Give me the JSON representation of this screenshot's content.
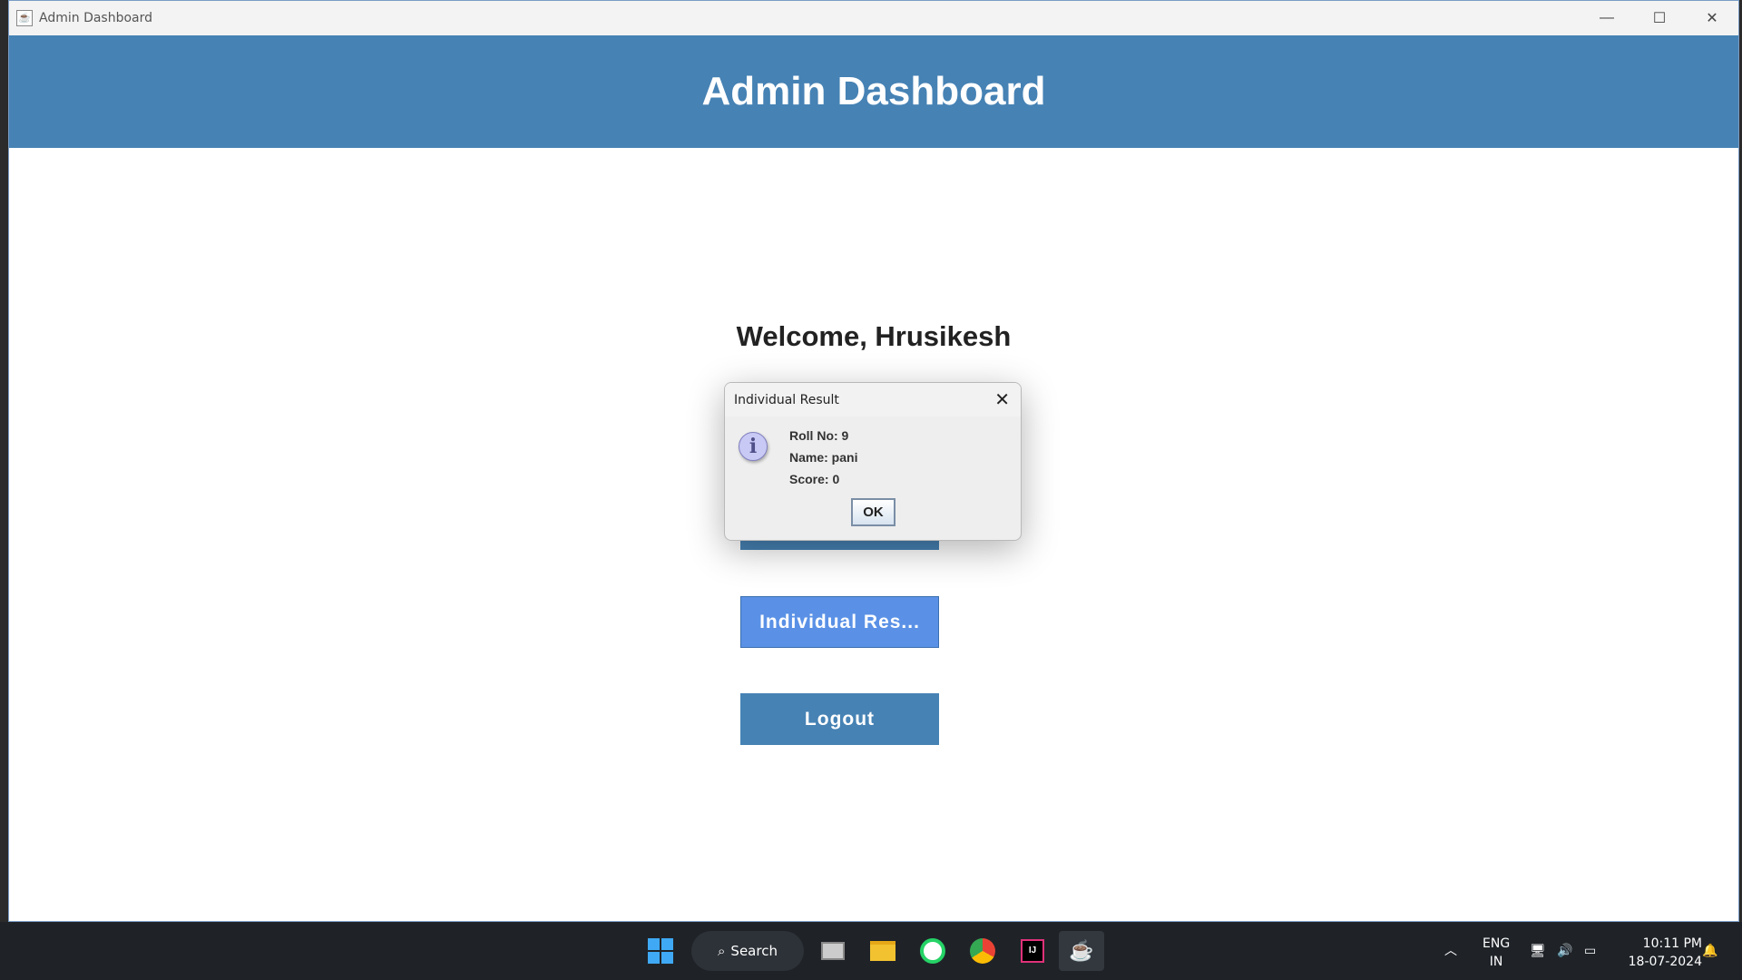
{
  "window": {
    "title": "Admin Dashboard",
    "icon": "java-icon"
  },
  "header": {
    "title": "Admin Dashboard"
  },
  "main": {
    "welcome": "Welcome, Hrusikesh",
    "buttons": [
      {
        "label": "Individual Res..."
      },
      {
        "label": "Logout"
      }
    ]
  },
  "dialog": {
    "title": "Individual Result",
    "lines": [
      "Roll No: 9",
      "Name: pani",
      "Score: 0"
    ],
    "ok": "OK",
    "icon": "info-icon"
  },
  "taskbar": {
    "search": "Search",
    "lang1": "ENG",
    "lang2": "IN",
    "time": "10:11 PM",
    "date": "18-07-2024"
  }
}
